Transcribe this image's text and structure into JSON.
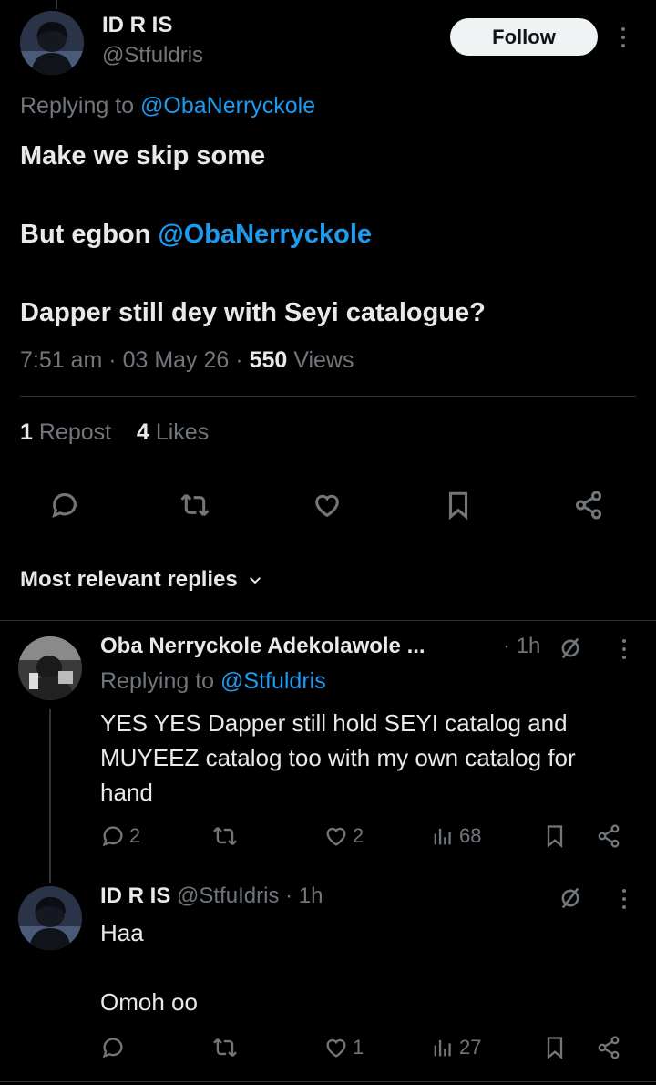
{
  "main_tweet": {
    "display_name": "ID R IS",
    "handle": "@Stfuldris",
    "follow_label": "Follow",
    "replying_prefix": "Replying to",
    "replying_to": "@ObaNerryckole",
    "line1": "Make we skip some",
    "line2_prefix": "But egbon",
    "line2_mention": "@ObaNerryckole",
    "line3": "Dapper still dey with Seyi catalogue?",
    "time": "7:51 am",
    "date": "03 May 26",
    "views_count": "550",
    "views_label": "Views",
    "reposts_count": "1",
    "reposts_label": "Repost",
    "likes_count": "4",
    "likes_label": "Likes"
  },
  "replies_sort": {
    "label": "Most relevant replies"
  },
  "replies": [
    {
      "display_name": "Oba Nerryckole Adekolawole ...",
      "time": "· 1h",
      "replying_prefix": "Replying to",
      "replying_to": "@Stfuldris",
      "text": "YES YES Dapper still hold SEYI catalog and MUYEEZ catalog too with my own catalog for hand",
      "reply_count": "2",
      "repost_count": "",
      "like_count": "2",
      "view_count": "68"
    },
    {
      "display_name": "ID R IS",
      "handle_time": "@StfuIdris · 1h",
      "text_line1": "Haa",
      "text_line2": "Omoh oo",
      "reply_count": "",
      "repost_count": "",
      "like_count": "1",
      "view_count": "27"
    }
  ],
  "colors": {
    "background": "#000000",
    "text": "#e7e9ea",
    "muted": "#71767b",
    "link": "#1d9bf0",
    "divider": "#2f3336"
  },
  "icons": [
    "more-icon",
    "reply-icon",
    "repost-icon",
    "like-icon",
    "bookmark-icon",
    "share-icon",
    "chevron-down-icon",
    "views-icon",
    "grok-icon"
  ]
}
